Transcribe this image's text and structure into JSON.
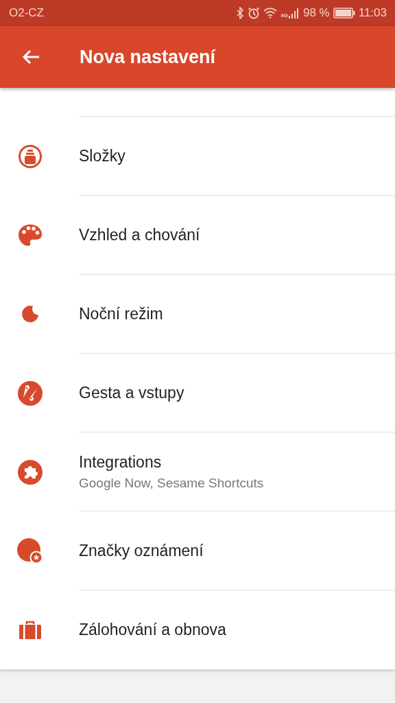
{
  "status_bar": {
    "carrier": "O2-CZ",
    "network": "4G",
    "battery": "98 %",
    "time": "11:03"
  },
  "app_bar": {
    "title": "Nova nastavení"
  },
  "items": [
    {
      "title": "Složky"
    },
    {
      "title": "Vzhled a chování"
    },
    {
      "title": "Noční režim"
    },
    {
      "title": "Gesta a vstupy"
    },
    {
      "title": "Integrations",
      "subtitle": "Google Now, Sesame Shortcuts"
    },
    {
      "title": "Značky oznámení"
    },
    {
      "title": "Zálohování a obnova"
    }
  ]
}
